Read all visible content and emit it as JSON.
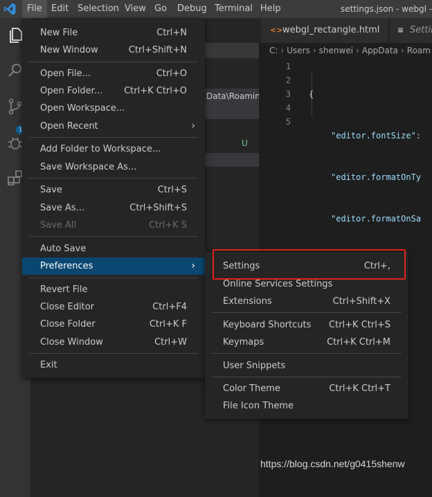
{
  "menubar": {
    "items": [
      "File",
      "Edit",
      "Selection",
      "View",
      "Go",
      "Debug",
      "Terminal",
      "Help"
    ],
    "window_title": "settings.json - webgl - Vis"
  },
  "activitybar": {
    "scm_badge": "1"
  },
  "sidebar": {
    "path_fragment": "Data\\Roamin...",
    "status_letter": "U"
  },
  "editor": {
    "tabs": [
      "webgl_rectangle.html",
      "Setting"
    ],
    "breadcrumb": [
      "C:",
      "Users",
      "shenwei",
      "AppData",
      "Roam"
    ],
    "line_numbers": [
      "1",
      "2",
      "3",
      "4",
      "5"
    ],
    "lines": [
      "{",
      "\"editor.fontSize\":",
      "\"editor.formatOnTy",
      "\"editor.formatOnSa",
      "}"
    ]
  },
  "file_menu": {
    "items": [
      {
        "label": "New File",
        "shortcut": "Ctrl+N"
      },
      {
        "label": "New Window",
        "shortcut": "Ctrl+Shift+N"
      },
      {
        "label": "Open File...",
        "shortcut": "Ctrl+O"
      },
      {
        "label": "Open Folder...",
        "shortcut": "Ctrl+K Ctrl+O"
      },
      {
        "label": "Open Workspace...",
        "shortcut": ""
      },
      {
        "label": "Open Recent",
        "shortcut": ""
      },
      {
        "label": "Add Folder to Workspace...",
        "shortcut": ""
      },
      {
        "label": "Save Workspace As...",
        "shortcut": ""
      },
      {
        "label": "Save",
        "shortcut": "Ctrl+S"
      },
      {
        "label": "Save As...",
        "shortcut": "Ctrl+Shift+S"
      },
      {
        "label": "Save All",
        "shortcut": "Ctrl+K S"
      },
      {
        "label": "Auto Save",
        "shortcut": ""
      },
      {
        "label": "Preferences",
        "shortcut": ""
      },
      {
        "label": "Revert File",
        "shortcut": ""
      },
      {
        "label": "Close Editor",
        "shortcut": "Ctrl+F4"
      },
      {
        "label": "Close Folder",
        "shortcut": "Ctrl+K F"
      },
      {
        "label": "Close Window",
        "shortcut": "Ctrl+W"
      },
      {
        "label": "Exit",
        "shortcut": ""
      }
    ]
  },
  "preferences_menu": {
    "items": [
      {
        "label": "Settings",
        "shortcut": "Ctrl+,"
      },
      {
        "label": "Online Services Settings",
        "shortcut": ""
      },
      {
        "label": "Extensions",
        "shortcut": "Ctrl+Shift+X"
      },
      {
        "label": "Keyboard Shortcuts",
        "shortcut": "Ctrl+K Ctrl+S"
      },
      {
        "label": "Keymaps",
        "shortcut": "Ctrl+K Ctrl+M"
      },
      {
        "label": "User Snippets",
        "shortcut": ""
      },
      {
        "label": "Color Theme",
        "shortcut": "Ctrl+K Ctrl+T"
      },
      {
        "label": "File Icon Theme",
        "shortcut": ""
      }
    ]
  },
  "watermark": "https://blog.csdn.net/g0415shenw",
  "colors": {
    "accent": "#094771",
    "highlight_box": "#e2231a",
    "json_key": "#9cdcfe",
    "untracked": "#73c991"
  }
}
